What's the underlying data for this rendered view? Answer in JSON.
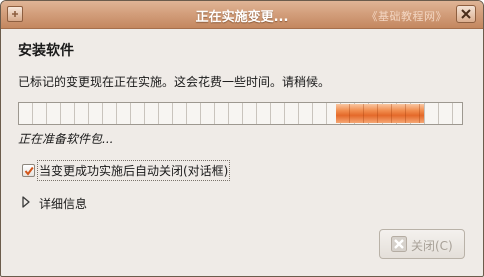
{
  "window": {
    "title": "正在实施变更...",
    "watermark": "《基础教程网》",
    "icons": {
      "app": "app-icon",
      "close": "close-icon"
    }
  },
  "content": {
    "heading": "安装软件",
    "description": "已标记的变更现在正在实施。这会花费一些时间。请稍候。",
    "status": "正在准备软件包...",
    "progress": {
      "activity_block_position": 0.72,
      "indeterminate": true
    },
    "checkbox": {
      "label": "当变更成功实施后自动关闭(对话框)",
      "checked": true
    },
    "expander": {
      "label": "详细信息",
      "expanded": false
    }
  },
  "buttons": {
    "close": {
      "label": "关闭(C)",
      "enabled": false,
      "icon": "close-icon"
    }
  },
  "colors": {
    "titlebar": "#d39f7c",
    "progress_accent": "#f18d4e",
    "window_bg": "#efebe7"
  }
}
